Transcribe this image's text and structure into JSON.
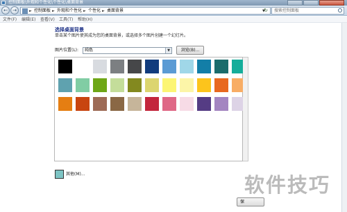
{
  "window": {
    "title": "控制面板\\外观和个性化\\个性化\\桌面背景"
  },
  "address_bar": {
    "crumbs": [
      "控制面板",
      "外观和个性化",
      "个性化",
      "桌面背景"
    ],
    "search_placeholder": "搜索控制面板"
  },
  "menu": {
    "items": [
      "文件(F)",
      "编辑(E)",
      "查看(V)",
      "工具(T)",
      "帮助(H)"
    ]
  },
  "main": {
    "heading": "选择桌面背景",
    "description": "单击某个图片使其成为您的桌面背景，或选择多个图片创建一个幻灯片。",
    "location_label": "图片位置(L):",
    "location_value": "纯色",
    "browse_label": "浏览(B)...",
    "other_label": "其他(M)...",
    "save_label": "保"
  },
  "swatch_rows": [
    [
      "#000000",
      "#ffffff",
      "#d8dbe0",
      "#7c7f82",
      "#464749",
      "#123c7d",
      "#5b9bd4",
      "#a0d7e8",
      "#137ea7",
      "#1b6c6c",
      "#15ad9a"
    ],
    [
      "#5fa2af",
      "#81cda4",
      "#6ea617",
      "#c4dd9a",
      "#83891f",
      "#dcd570",
      "#fcf574",
      "#fcf5a8",
      "#fcc41c",
      "#e8681f",
      "#f8ad65"
    ],
    [
      "#e57e12",
      "#c84510",
      "#9e6b56",
      "#8a6845",
      "#c6b59a",
      "#c3263c",
      "#df6886",
      "#f7dbe6",
      "#553c84",
      "#a485c1",
      "#ddd3e6"
    ]
  ],
  "other_color": "#7dc4c4",
  "watermark": "软件技巧"
}
